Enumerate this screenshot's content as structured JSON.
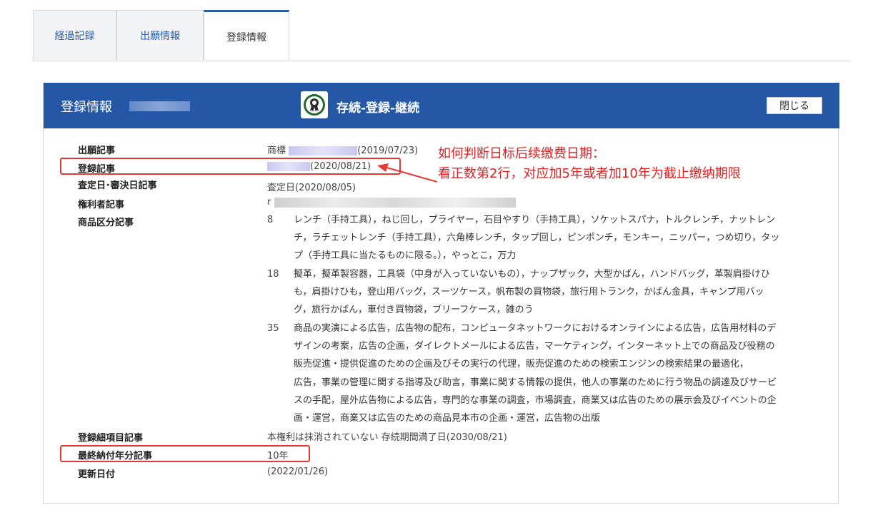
{
  "tabs": [
    {
      "label": "経過記録"
    },
    {
      "label": "出願情報"
    },
    {
      "label": "登録情報"
    }
  ],
  "panel": {
    "title": "登録情報",
    "status": "存続-登録-継続",
    "close_label": "閉じる",
    "status_icon": "award-medal-icon"
  },
  "rows": {
    "application": {
      "label": "出願記事",
      "prefix": "商標",
      "date": "(2019/07/23)"
    },
    "registration": {
      "label": "登録記事",
      "date": "(2020/08/21)"
    },
    "decision": {
      "label": "査定日･審決日記事",
      "value": "査定日(2020/08/05)"
    },
    "owner": {
      "label": "権利者記事",
      "value": "r"
    },
    "goods": {
      "label": "商品区分記事"
    },
    "detail": {
      "label": "登録細項目記事",
      "value": "本権利は抹消されていない  存続期間満了日(2030/08/21)"
    },
    "last_payment": {
      "label": "最終納付年分記事",
      "value": "10年"
    },
    "updated": {
      "label": "更新日付",
      "value": "(2022/01/26)"
    }
  },
  "classes": [
    {
      "num": "8",
      "text": "レンチ（手持工具），ねじ回し，プライヤー，石目やすり（手持工具），ソケットスパナ，トルクレンチ，ナットレンチ，ラチェットレンチ（手持工具），六角棒レンチ，タップ回し，ピンポンチ，モンキー，ニッパー，つめ切り，タップ（手持工具に当たるものに限る。），やっとこ，万力"
    },
    {
      "num": "18",
      "text": "擬革，擬革製容器，工具袋（中身が入っていないもの），ナップザック，大型かばん，ハンドバッグ，革製肩掛けひも，肩掛けひも，登山用バッグ，スーツケース，帆布製の買物袋，旅行用トランク，かばん金具，キャンプ用バッグ，旅行かばん，車付き買物袋，ブリーフケース，雑のう"
    },
    {
      "num": "35",
      "text": "商品の実演による広告，広告物の配布，コンピュータネットワークにおけるオンラインによる広告，広告用材料のデザインの考案，広告の企画，ダイレクトメールによる広告，マーケティング，インターネット上での商品及び役務の販売促進・提供促進のための企画及びその実行の代理，販売促進のための検索エンジンの検索結果の最適化，",
      "text2": "広告，事業の管理に関する指導及び助言，事業に関する情報の提供，他人の事業のために行う物品の調達及びサービスの手配，屋外広告物による広告，専門的な事業の調査，市場調査，商業又は広告のための展示会及びイベントの企画・運営，商業又は広告のための商品見本市の企画・運営，広告物の出版"
    }
  ],
  "annotation": {
    "line1": "如何判断日标后续缴费日期：",
    "line2": "看正数第2行，对应加5年或者加10年为截止缴纳期限"
  },
  "colors": {
    "header_bg": "#2557a7",
    "tab_text": "#2a5aa8",
    "annotation": "#e53935"
  }
}
